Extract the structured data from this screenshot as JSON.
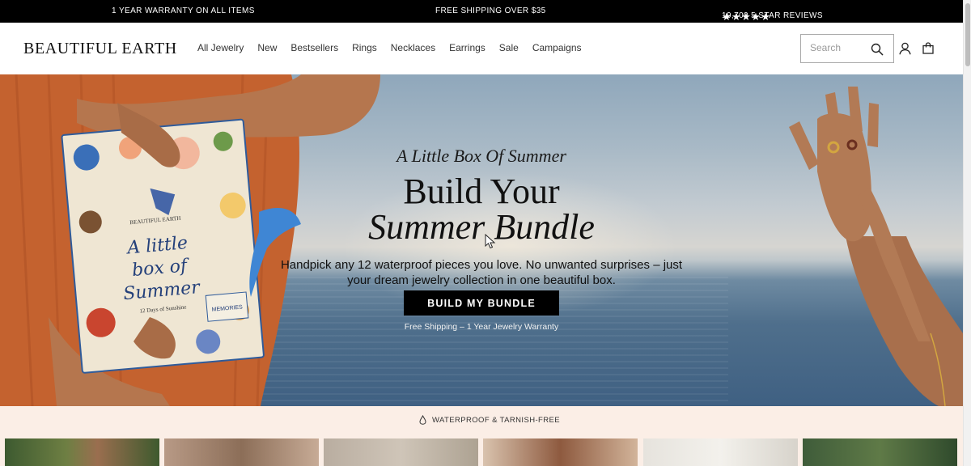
{
  "announcement": {
    "warranty": "1 YEAR WARRANTY ON ALL ITEMS",
    "shipping": "FREE SHIPPING OVER $35",
    "stars": "★★★★★",
    "reviews": "19,700 5 STAR REVIEWS"
  },
  "header": {
    "logo": "BEAUTIFUL EARTH",
    "nav": [
      "All Jewelry",
      "New",
      "Bestsellers",
      "Rings",
      "Necklaces",
      "Earrings",
      "Sale",
      "Campaigns"
    ],
    "search_placeholder": "Search"
  },
  "hero": {
    "eyebrow": "A Little Box Of Summer",
    "title_line1": "Build Your",
    "title_line2": "Summer Bundle",
    "body": "Handpick any 12 waterproof pieces you love. No unwanted surprises – just your dream jewelry collection in one beautiful box.",
    "cta": "BUILD MY BUNDLE",
    "note": "Free Shipping – 1 Year Jewelry Warranty",
    "box_brand": "BEAUTIFUL EARTH",
    "box_title_1": "A little",
    "box_title_2": "box of",
    "box_title_3": "Summer",
    "box_subtitle": "12 Days of Sunshine",
    "box_card": "MEMORIES"
  },
  "usp": {
    "icon": "water-drop-icon",
    "text": "WATERPROOF & TARNISH-FREE"
  },
  "colors": {
    "announcement_bg": "#000000",
    "cta_bg": "#000000",
    "band_bg": "#fbeee6",
    "dress": "#c4622f"
  }
}
